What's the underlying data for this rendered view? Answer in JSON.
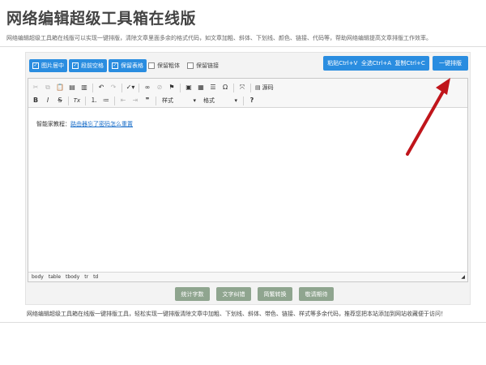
{
  "header": {
    "title": "网络编辑超级工具箱在线版",
    "description": "网络编辑超级工具箱在线版可以实现一键排版，清除文章里面多余的格式代码，如文章加粗、斜体、下划线、颜色、链接、代码等，帮助网络编辑提高文章排版工作效率。"
  },
  "options": [
    {
      "label": "图片居中",
      "checked": true
    },
    {
      "label": "段前空格",
      "checked": true
    },
    {
      "label": "保留表格",
      "checked": true
    },
    {
      "label": "保留粗体",
      "checked": false
    },
    {
      "label": "保留链接",
      "checked": false
    }
  ],
  "actions": {
    "paste": "粘贴Ctrl+V",
    "select_all": "全选Ctrl+A",
    "copy": "复制Ctrl+C",
    "one_click": "一键排版"
  },
  "toolbar": {
    "source_label": "源码",
    "style_select": "样式",
    "format_select": "格式",
    "bold": "B",
    "italic": "I",
    "strike": "S",
    "clear_format": "Tx",
    "help": "?"
  },
  "editor": {
    "content_prefix": "智能家教程：",
    "content_link": "路由器忘了密码怎么重置"
  },
  "statusbar": [
    "body",
    "table",
    "tbody",
    "tr",
    "td"
  ],
  "bottom_buttons": [
    "统计字数",
    "文字纠错",
    "简繁转换",
    "敬请期待"
  ],
  "footer": {
    "text": "网络编辑超级工具箱在线版一键排版工具，轻松实现一键排版清除文章中加粗、下划线、斜体、带色、链接、样式等多余代码，推荐您把本站添加到网站收藏便于访问！"
  },
  "colors": {
    "primary_blue": "#2a8de0",
    "gray_green_button": "#8fa58f",
    "annotation_arrow": "#c0151b"
  }
}
